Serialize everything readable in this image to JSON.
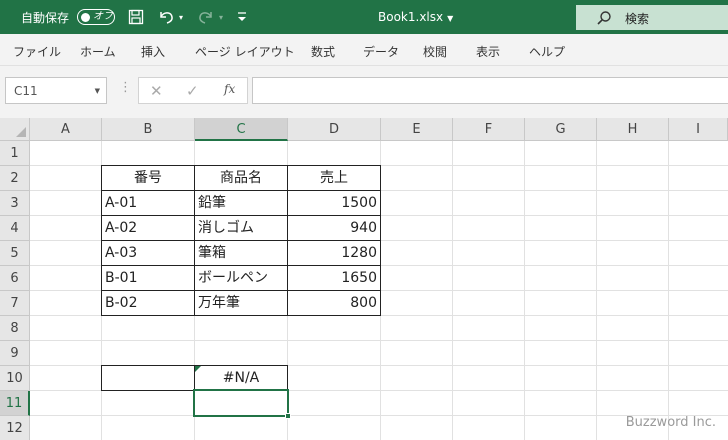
{
  "titlebar": {
    "autosave_label": "自動保存",
    "autosave_state": "オフ",
    "document_title": "Book1.xlsx",
    "search_placeholder": "検索",
    "icons": [
      "save-icon",
      "undo-icon",
      "redo-icon",
      "quick-access-customize-icon",
      "search-icon"
    ]
  },
  "menu": [
    "ファイル",
    "ホーム",
    "挿入",
    "ページ レイアウト",
    "数式",
    "データ",
    "校閲",
    "表示",
    "ヘルプ"
  ],
  "formula_bar": {
    "name_box": "C11",
    "formula": "",
    "icons": [
      "cancel-icon",
      "enter-icon",
      "function-icon"
    ],
    "fx_label": "fx"
  },
  "sheet": {
    "columns": [
      "A",
      "B",
      "C",
      "D",
      "E",
      "F",
      "G",
      "H",
      "I"
    ],
    "rows": [
      "1",
      "2",
      "3",
      "4",
      "5",
      "6",
      "7",
      "8",
      "9",
      "10",
      "11",
      "12"
    ],
    "selected_column": "C",
    "selected_row": "11",
    "table": {
      "headers": [
        "番号",
        "商品名",
        "売上"
      ],
      "rows": [
        [
          "A-01",
          "鉛筆",
          "1500"
        ],
        [
          "A-02",
          "消しゴム",
          "940"
        ],
        [
          "A-03",
          "筆箱",
          "1280"
        ],
        [
          "B-01",
          "ボールペン",
          "1650"
        ],
        [
          "B-02",
          "万年筆",
          "800"
        ]
      ]
    },
    "lookup": {
      "B10": "",
      "C10": "#N/A"
    },
    "active_cell": "C11"
  },
  "watermark": "Buzzword Inc.",
  "colors": {
    "excel_green": "#217346",
    "search_bg": "#c8e1d2"
  }
}
